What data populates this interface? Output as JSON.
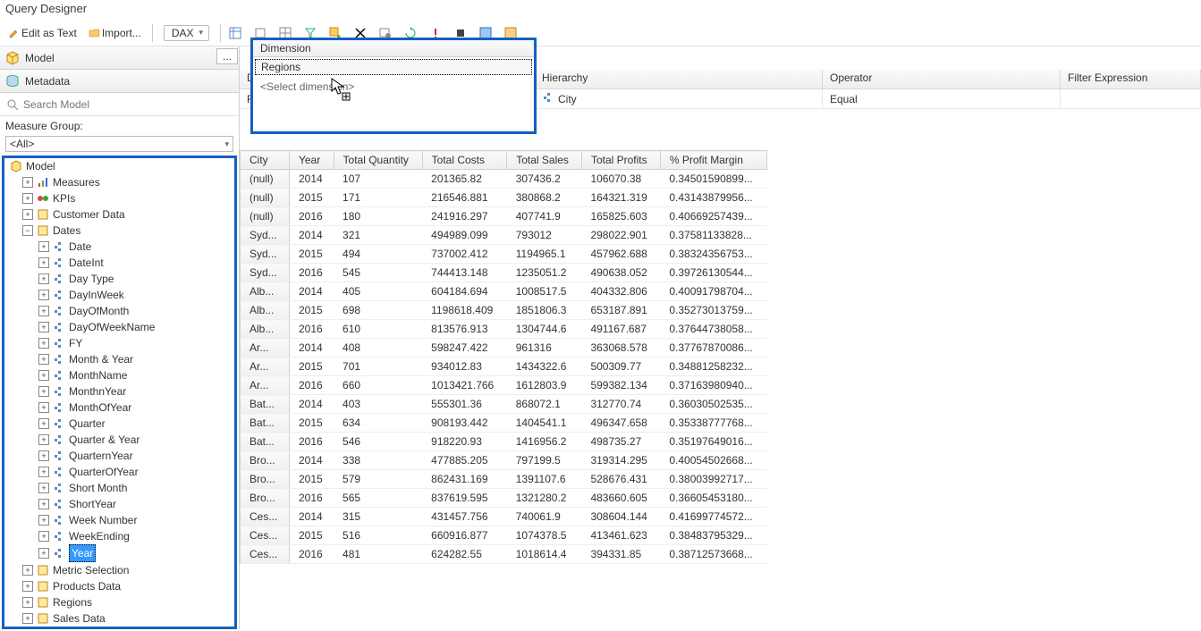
{
  "title": "Query Designer",
  "toolbar": {
    "edit_as_text": "Edit as Text",
    "import": "Import...",
    "lang": "DAX"
  },
  "left": {
    "model_label": "Model",
    "metadata_label": "Metadata",
    "search_placeholder": "Search Model",
    "measure_group_label": "Measure Group:",
    "measure_group_value": "<All>",
    "tree": {
      "root": "Model",
      "measures": "Measures",
      "kpis": "KPIs",
      "customer_data": "Customer Data",
      "dates": "Dates",
      "date_children": [
        "Date",
        "DateInt",
        "Day Type",
        "DayInWeek",
        "DayOfMonth",
        "DayOfWeekName",
        "FY",
        "Month & Year",
        "MonthName",
        "MonthnYear",
        "MonthOfYear",
        "Quarter",
        "Quarter & Year",
        "QuarternYear",
        "QuarterOfYear",
        "Short Month",
        "ShortYear",
        "Week Number",
        "WeekEnding",
        "Year"
      ],
      "selected": "Year",
      "metric_selection": "Metric Selection",
      "products_data": "Products Data",
      "regions": "Regions",
      "sales_data": "Sales Data"
    }
  },
  "filter": {
    "headers": {
      "dimension": "Dimension",
      "hierarchy": "Hierarchy",
      "operator": "Operator",
      "filter_expression": "Filter Expression"
    },
    "values": {
      "dimension": "Regions",
      "hierarchy": "City",
      "operator": "Equal",
      "filter_expression": ""
    },
    "select_dimension": "<Select dimension>"
  },
  "chart_data": {
    "type": "table",
    "columns": [
      "City",
      "Year",
      "Total Quantity",
      "Total Costs",
      "Total Sales",
      "Total Profits",
      "% Profit Margin"
    ],
    "rows": [
      [
        "(null)",
        "2014",
        "107",
        "201365.82",
        "307436.2",
        "106070.38",
        "0.34501590899..."
      ],
      [
        "(null)",
        "2015",
        "171",
        "216546.881",
        "380868.2",
        "164321.319",
        "0.43143879956..."
      ],
      [
        "(null)",
        "2016",
        "180",
        "241916.297",
        "407741.9",
        "165825.603",
        "0.40669257439..."
      ],
      [
        "Syd...",
        "2014",
        "321",
        "494989.099",
        "793012",
        "298022.901",
        "0.37581133828..."
      ],
      [
        "Syd...",
        "2015",
        "494",
        "737002.412",
        "1194965.1",
        "457962.688",
        "0.38324356753..."
      ],
      [
        "Syd...",
        "2016",
        "545",
        "744413.148",
        "1235051.2",
        "490638.052",
        "0.39726130544..."
      ],
      [
        "Alb...",
        "2014",
        "405",
        "604184.694",
        "1008517.5",
        "404332.806",
        "0.40091798704..."
      ],
      [
        "Alb...",
        "2015",
        "698",
        "1198618.409",
        "1851806.3",
        "653187.891",
        "0.35273013759..."
      ],
      [
        "Alb...",
        "2016",
        "610",
        "813576.913",
        "1304744.6",
        "491167.687",
        "0.37644738058..."
      ],
      [
        "Ar...",
        "2014",
        "408",
        "598247.422",
        "961316",
        "363068.578",
        "0.37767870086..."
      ],
      [
        "Ar...",
        "2015",
        "701",
        "934012.83",
        "1434322.6",
        "500309.77",
        "0.34881258232..."
      ],
      [
        "Ar...",
        "2016",
        "660",
        "1013421.766",
        "1612803.9",
        "599382.134",
        "0.37163980940..."
      ],
      [
        "Bat...",
        "2014",
        "403",
        "555301.36",
        "868072.1",
        "312770.74",
        "0.36030502535..."
      ],
      [
        "Bat...",
        "2015",
        "634",
        "908193.442",
        "1404541.1",
        "496347.658",
        "0.35338777768..."
      ],
      [
        "Bat...",
        "2016",
        "546",
        "918220.93",
        "1416956.2",
        "498735.27",
        "0.35197649016..."
      ],
      [
        "Bro...",
        "2014",
        "338",
        "477885.205",
        "797199.5",
        "319314.295",
        "0.40054502668..."
      ],
      [
        "Bro...",
        "2015",
        "579",
        "862431.169",
        "1391107.6",
        "528676.431",
        "0.38003992717..."
      ],
      [
        "Bro...",
        "2016",
        "565",
        "837619.595",
        "1321280.2",
        "483660.605",
        "0.36605453180..."
      ],
      [
        "Ces...",
        "2014",
        "315",
        "431457.756",
        "740061.9",
        "308604.144",
        "0.41699774572..."
      ],
      [
        "Ces...",
        "2015",
        "516",
        "660916.877",
        "1074378.5",
        "413461.623",
        "0.38483795329..."
      ],
      [
        "Ces...",
        "2016",
        "481",
        "624282.55",
        "1018614.4",
        "394331.85",
        "0.38712573668..."
      ]
    ]
  }
}
